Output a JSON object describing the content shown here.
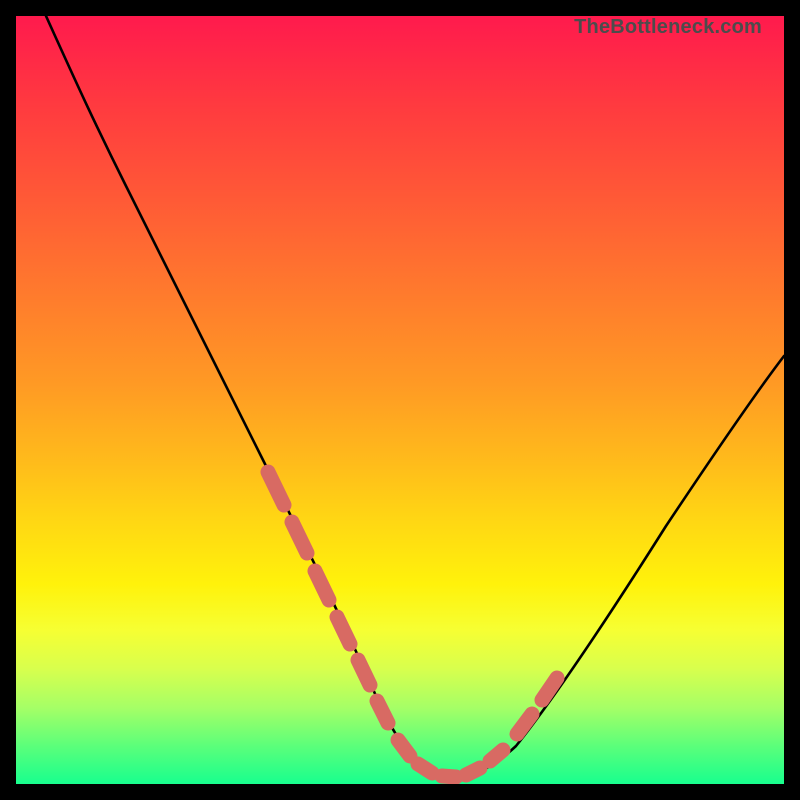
{
  "attribution": "TheBottleneck.com",
  "chart_data": {
    "type": "line",
    "title": "",
    "xlabel": "",
    "ylabel": "",
    "xlim": [
      0,
      100
    ],
    "ylim": [
      0,
      100
    ],
    "series": [
      {
        "name": "curve",
        "x": [
          4,
          10,
          18,
          25,
          32,
          38,
          43,
          47,
          50,
          53,
          55,
          58,
          60,
          64,
          70,
          78,
          88,
          100
        ],
        "values": [
          100,
          88,
          73,
          59,
          45,
          31,
          20,
          11,
          5,
          1.5,
          0.6,
          0.6,
          0.8,
          3,
          10,
          22,
          37,
          55
        ]
      }
    ],
    "highlight_segments": [
      {
        "order": 0,
        "x_range": [
          32,
          47
        ],
        "note": "left descending flank"
      },
      {
        "order": 1,
        "x_range": [
          49,
          62
        ],
        "note": "trough"
      },
      {
        "order": 2,
        "x_range": [
          64,
          70
        ],
        "note": "right ascending flank"
      }
    ],
    "colors": {
      "curve": "#000000",
      "highlight": "#d86a63",
      "background_top": "#ff1a4d",
      "background_bottom": "#18ff8e"
    }
  }
}
